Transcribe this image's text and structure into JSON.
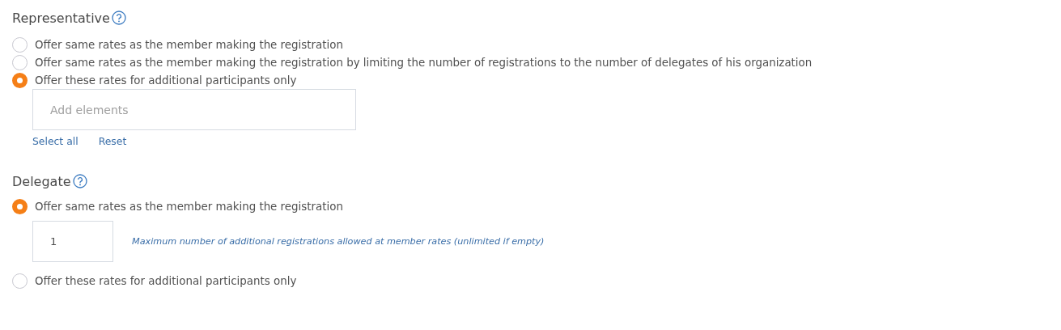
{
  "sections": [
    {
      "title": "Representative",
      "options": [
        {
          "label": "Offer same rates as the member making the registration",
          "selected": false
        },
        {
          "label": "Offer same rates as the member making the registration by limiting the number of registrations to the number of delegates of his organization",
          "selected": false
        },
        {
          "label": "Offer these rates for additional participants only",
          "selected": true,
          "kind": "elements",
          "field": {
            "placeholder": "Add elements"
          },
          "links": [
            "Select all",
            "Reset"
          ]
        }
      ]
    },
    {
      "title": "Delegate",
      "options": [
        {
          "label": "Offer same rates as the member making the registration",
          "selected": true,
          "kind": "number",
          "field": {
            "value": "1",
            "hint": "Maximum number of additional registrations allowed at member rates (unlimited if empty)"
          }
        },
        {
          "label": "Offer these rates for additional participants only",
          "selected": false
        }
      ]
    }
  ]
}
